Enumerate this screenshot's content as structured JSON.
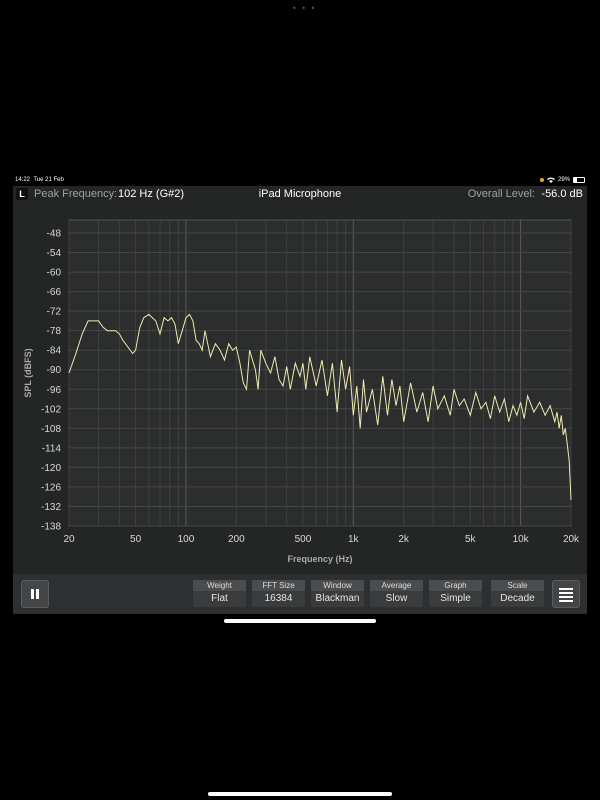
{
  "status_bar": {
    "time": "14:22",
    "date": "Tue 21 Feb",
    "battery": "29%",
    "battery_level": 0.29,
    "privacy_dot_color": "#f0a030"
  },
  "header": {
    "mode_button": "L",
    "peak_label": "Peak Frequency:",
    "peak_value": "102 Hz (G#2)",
    "source": "iPad Microphone",
    "overall_label": "Overall Level:",
    "overall_value": "-56.0 dB"
  },
  "chart_data": {
    "type": "line",
    "xlabel": "Frequency (Hz)",
    "ylabel": "SPL (dBFS)",
    "x_scale": "log",
    "xlim": [
      20,
      20000
    ],
    "ylim": [
      -138,
      -44
    ],
    "x_ticks": [
      20,
      50,
      100,
      200,
      500,
      1000,
      2000,
      5000,
      10000,
      20000
    ],
    "x_tick_labels": [
      "20",
      "50",
      "100",
      "200",
      "500",
      "1k",
      "2k",
      "5k",
      "10k",
      "20k"
    ],
    "y_ticks": [
      -48,
      -54,
      -60,
      -66,
      -72,
      -78,
      -84,
      -90,
      -96,
      -102,
      -108,
      -114,
      -120,
      -126,
      -132,
      -138
    ],
    "grid": true,
    "line_color": "#eeeab0",
    "series": [
      {
        "x": [
          20,
          22,
          24,
          26,
          28,
          30,
          32,
          34,
          36,
          38,
          40,
          42,
          45,
          48,
          50,
          53,
          56,
          60,
          63,
          66,
          70,
          74,
          78,
          82,
          86,
          90,
          95,
          100,
          105,
          110,
          115,
          120,
          125,
          130,
          140,
          150,
          160,
          170,
          180,
          190,
          200,
          210,
          220,
          230,
          240,
          250,
          260,
          270,
          280,
          300,
          320,
          340,
          360,
          380,
          400,
          420,
          450,
          480,
          500,
          520,
          550,
          600,
          650,
          700,
          750,
          800,
          850,
          900,
          950,
          1000,
          1050,
          1100,
          1150,
          1200,
          1300,
          1400,
          1500,
          1600,
          1700,
          1800,
          1900,
          2000,
          2200,
          2400,
          2600,
          2800,
          3000,
          3200,
          3500,
          3800,
          4000,
          4300,
          4600,
          5000,
          5400,
          5800,
          6200,
          6600,
          7000,
          7500,
          8000,
          8500,
          9000,
          9500,
          10000,
          10500,
          11000,
          12000,
          13000,
          14000,
          15000,
          16000,
          16500,
          17000,
          17500,
          18000,
          18500,
          19000,
          19500,
          20000
        ],
        "y": [
          -91,
          -85,
          -79,
          -75,
          -75,
          -75,
          -77,
          -78,
          -78,
          -78,
          -79,
          -81,
          -83,
          -85,
          -84,
          -77,
          -74,
          -73,
          -74,
          -75,
          -79,
          -74,
          -75,
          -74,
          -76,
          -82,
          -78,
          -74,
          -73,
          -75,
          -81,
          -82,
          -84,
          -78,
          -86,
          -82,
          -84,
          -87,
          -82,
          -84,
          -83,
          -88,
          -94,
          -96,
          -84,
          -87,
          -90,
          -96,
          -84,
          -88,
          -91,
          -86,
          -93,
          -95,
          -89,
          -96,
          -88,
          -92,
          -88,
          -96,
          -86,
          -95,
          -87,
          -98,
          -88,
          -103,
          -87,
          -96,
          -89,
          -104,
          -95,
          -108,
          -93,
          -103,
          -96,
          -107,
          -92,
          -104,
          -93,
          -101,
          -95,
          -106,
          -94,
          -103,
          -97,
          -106,
          -95,
          -102,
          -98,
          -104,
          -96,
          -101,
          -99,
          -104,
          -97,
          -102,
          -100,
          -105,
          -98,
          -103,
          -99,
          -106,
          -101,
          -104,
          -100,
          -105,
          -98,
          -103,
          -100,
          -104,
          -101,
          -106,
          -103,
          -108,
          -104,
          -110,
          -108,
          -113,
          -118,
          -130
        ]
      }
    ]
  },
  "toolbar": {
    "pause_icon": "pause-icon",
    "menu_icon": "hamburger-menu-icon",
    "controls": [
      {
        "label": "Weight",
        "value": "Flat"
      },
      {
        "label": "FFT Size",
        "value": "16384"
      },
      {
        "label": "Window",
        "value": "Blackman"
      },
      {
        "label": "Average",
        "value": "Slow"
      },
      {
        "label": "Graph",
        "value": "Simple"
      },
      {
        "label": "Scale",
        "value": "Decade"
      }
    ]
  }
}
